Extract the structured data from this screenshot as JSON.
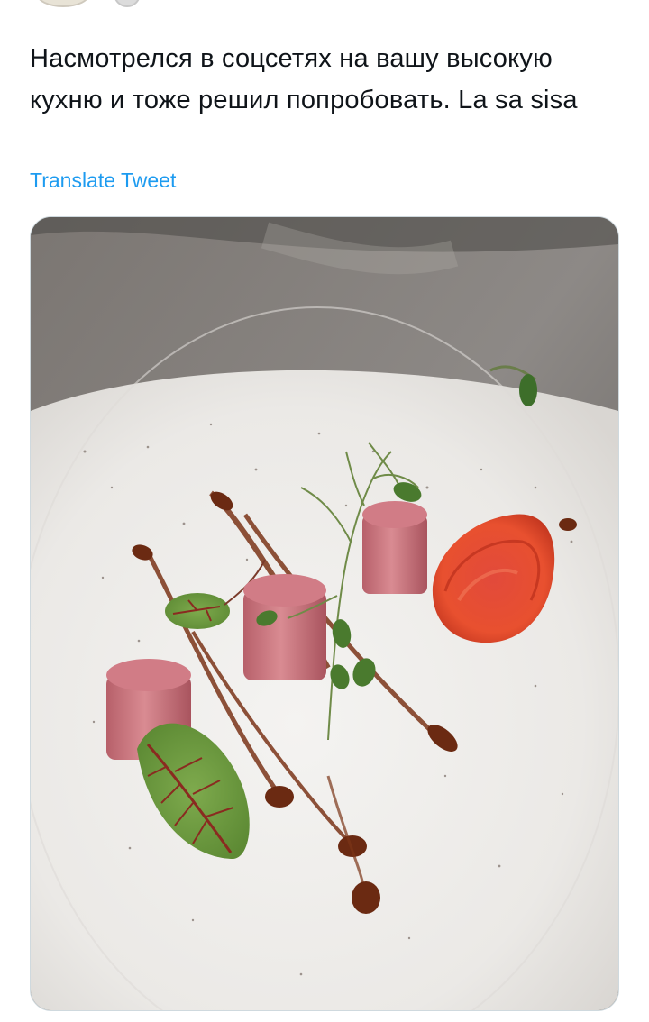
{
  "tweet": {
    "text": "Насмотрелся в соцсетях на вашу высокую кухню и тоже решил попробовать. La sa sisa",
    "translate_label": "Translate Tweet"
  },
  "media": {
    "content": "food-photo"
  },
  "colors": {
    "text": "#0f1419",
    "link": "#1d9bf0",
    "card_border": "#cfd9de"
  }
}
